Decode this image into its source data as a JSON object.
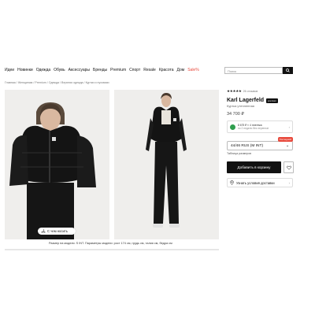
{
  "nav": {
    "items": [
      "Идеи",
      "Новинки",
      "Одежда",
      "Обувь",
      "Аксессуары",
      "Бренды",
      "Premium",
      "Спорт",
      "Resale",
      "Красота",
      "Дом"
    ],
    "sale": "Sale%"
  },
  "search": {
    "placeholder": "Поиск",
    "icon": "search-icon"
  },
  "breadcrumb": [
    "Главная",
    "Женщинам",
    "Premium",
    "Одежда",
    "Верхняя одежда",
    "Куртки и пуховики"
  ],
  "gallery": {
    "pill_label": "С чем носить",
    "caption": "Размер на модели: S INT. Параметры модели: рост 174 см, грудь см, талия см, бедра см"
  },
  "product": {
    "rating_count": "26 отзывов",
    "brand": "Karl Lagerfeld",
    "badge": "premium",
    "type": "Куртка утепленная",
    "price": "34 700 ₽",
    "installment_line1": "8 675 ₽ × 4 платежа",
    "installment_line2": "по 2 недели без переплат",
    "size": "44/46 RUS (M INT)",
    "size_tag": "Последний",
    "size_table": "Таблица размеров",
    "add_to_cart": "Добавить в корзину",
    "delivery": "Узнать условия доставки"
  },
  "colors": {
    "sale": "#e8483b",
    "accent": "#111111",
    "installment": "#2f9e4e"
  }
}
